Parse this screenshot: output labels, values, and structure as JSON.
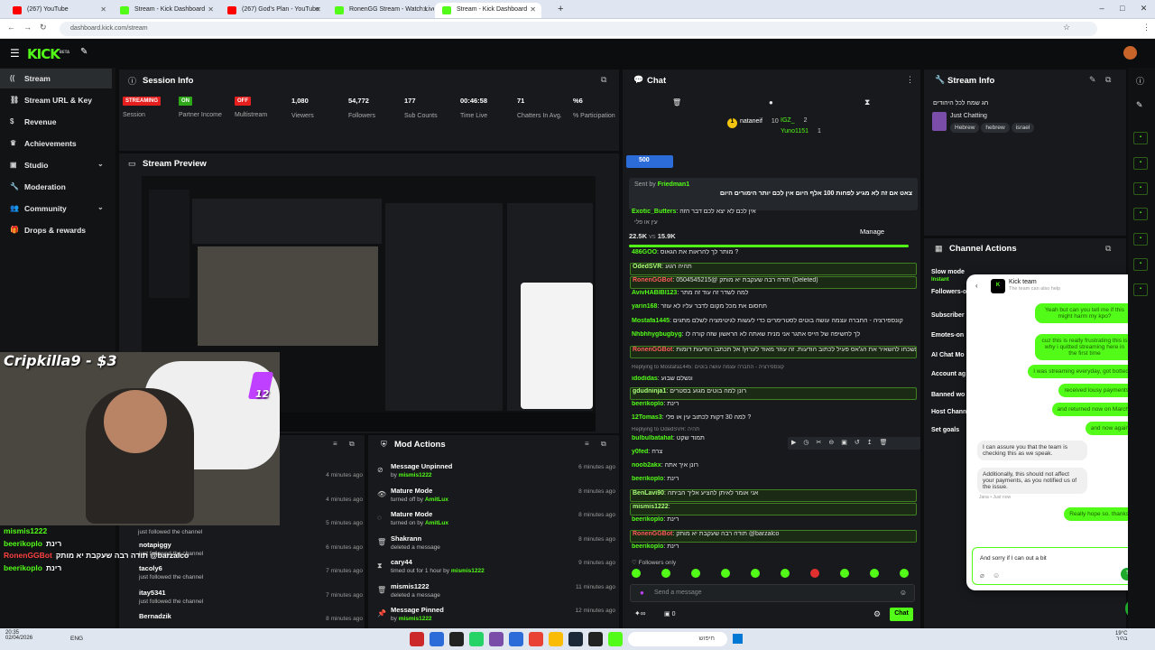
{
  "browser": {
    "tabs": [
      {
        "label": "(267) YouTube",
        "color": "#ff0000"
      },
      {
        "label": "Stream - Kick Dashboard",
        "color": "#53fc18"
      },
      {
        "label": "(267) God's Plan - YouTube",
        "color": "#ff0000"
      },
      {
        "label": "RonenGG Stream - Watch Live",
        "color": "#53fc18"
      },
      {
        "label": "Stream - Kick Dashboard",
        "color": "#53fc18"
      }
    ],
    "url": "dashboard.kick.com/stream",
    "new_tab": "+",
    "win_controls": [
      "–",
      "□",
      "✕"
    ]
  },
  "brand": {
    "logo": "KICK",
    "beta": "BETA"
  },
  "sidebar": {
    "items": [
      {
        "label": "Stream",
        "icon": "broadcast-icon"
      },
      {
        "label": "Stream URL & Key",
        "icon": "link-icon"
      },
      {
        "label": "Revenue",
        "icon": "dollar-icon"
      },
      {
        "label": "Achievements",
        "icon": "trophy-icon"
      },
      {
        "label": "Studio",
        "icon": "studio-icon"
      },
      {
        "label": "Moderation",
        "icon": "wrench-icon"
      },
      {
        "label": "Community",
        "icon": "people-icon"
      },
      {
        "label": "Drops & rewards",
        "icon": "gift-icon"
      }
    ]
  },
  "session": {
    "title": "Session Info",
    "stats": [
      {
        "value": "STREAMING",
        "label": "Session",
        "type": "badge",
        "color": "#e51e1e"
      },
      {
        "value": "ON",
        "label": "Partner Income",
        "type": "badge",
        "color": "#2fa81a"
      },
      {
        "value": "OFF",
        "label": "Multistream",
        "type": "badge",
        "color": "#e51e1e"
      },
      {
        "value": "1,080",
        "label": "Viewers"
      },
      {
        "value": "54,772",
        "label": "Followers"
      },
      {
        "value": "177",
        "label": "Sub Counts"
      },
      {
        "value": "00:46:58",
        "label": "Time Live"
      },
      {
        "value": "71",
        "label": "Chatters In Avg."
      },
      {
        "value": "%6",
        "label": "% Participation"
      }
    ]
  },
  "preview": {
    "title": "Stream Preview"
  },
  "overlay": {
    "donation": "Cripkilla9 - $3",
    "sub_count": "12"
  },
  "recent": {
    "items": [
      {
        "time": "4 minutes ago"
      },
      {
        "time": "4 minutes ago"
      },
      {
        "time": "5 minutes ago"
      },
      {
        "name": "notapiggy",
        "desc": "just followed the channel",
        "time": "6 minutes ago"
      },
      {
        "name": "tacoly6",
        "desc": "just followed the channel",
        "time": "7 minutes ago"
      },
      {
        "name": "itay5341",
        "desc": "just followed the channel",
        "time": "7 minutes ago"
      },
      {
        "name": "Bernadzik",
        "desc": "",
        "time": "8 minutes ago"
      }
    ],
    "partial_desc": "just followed the channel"
  },
  "overlay_chat": [
    {
      "user": "mismis1222",
      "text": ""
    },
    {
      "user": "beerikoplo",
      "text": "רינת"
    },
    {
      "user": "RonenGGBot",
      "text": "תודה רבה שעקבת יא מותק @barzalco"
    },
    {
      "user": "beerikoplo",
      "text": "רינת"
    }
  ],
  "mod": {
    "title": "Mod Actions",
    "items": [
      {
        "title": "Message Unpinned",
        "by": "by",
        "who": "mismis1222",
        "time": "6 minutes ago",
        "icon": "unpin-icon"
      },
      {
        "title": "Mature Mode",
        "by": "turned off by",
        "who": "AmitLux",
        "time": "8 minutes ago",
        "icon": "eye-icon"
      },
      {
        "title": "Mature Mode",
        "by": "turned on by",
        "who": "AmitLux",
        "time": "8 minutes ago",
        "icon": "eye-off-icon"
      },
      {
        "title": "Shakrann",
        "by": "deleted a message",
        "who": "",
        "time": "8 minutes ago",
        "icon": "trash-icon"
      },
      {
        "title": "cary44",
        "by": "timed out for 1 hour by",
        "who": "mismis1222",
        "time": "9 minutes ago",
        "icon": "clock-icon"
      },
      {
        "title": "mismis1222",
        "by": "deleted a message",
        "who": "",
        "time": "11 minutes ago",
        "icon": "trash-icon"
      },
      {
        "title": "Message Pinned",
        "by": "by",
        "who": "mismis1222",
        "time": "12 minutes ago",
        "icon": "pin-icon"
      }
    ]
  },
  "chat": {
    "title": "Chat",
    "leaderboard": [
      {
        "rank": "1",
        "name": "nataneif",
        "count": "10"
      },
      {
        "rank": "",
        "name": "IGZ_",
        "count": "2"
      },
      {
        "rank": "",
        "name": "Yuno1151",
        "count": "1"
      }
    ],
    "goal": "500",
    "pinned": {
      "label": "Sent by",
      "user": "Friedman1",
      "text": "צאט אם זה לא מגיע לפחות 100 אלף היום אין לכם יותר הימורים היום"
    },
    "prediction": {
      "left": "22.5K",
      "vs": "vs",
      "right": "15.9K",
      "manage": "Manage",
      "top": "עין או פלי"
    },
    "lines": [
      {
        "user": "Exotic_Butters",
        "text": "אין לכם לא יצא לכם דבר הזה",
        "hl": false
      },
      {
        "user": "486GOO",
        "text": "מותר לך להראות את הגאוס ?",
        "hl": false
      },
      {
        "user": "OdedSVR",
        "text": "תהיה רגוע",
        "hl": true
      },
      {
        "user": "RonenGGBot",
        "text": "0504545215@ תודה רבה שעקבת יא מותק (Deleted)",
        "hl": true,
        "red": true
      },
      {
        "user": "AvivHABIBI123",
        "text": "למה לשדר זה עוד זה מתר",
        "hl": false
      },
      {
        "user": "yarin168",
        "text": "תחסום את מכל מקום לדבר עליו לא עוזר",
        "hl": false
      },
      {
        "user": "Mostafa1445",
        "text": "קונספירציה - החברה עצמה עושה בוטים לסטרימרים כדי לעשות לגיטימציה לשלם מתגים",
        "hl": false
      },
      {
        "user": "Nhbhhygbugbyg",
        "text": "לך לחשיפה של הייס אתגר אני מנית שאתה לא הראשון שזה קורה לו",
        "hl": false
      },
      {
        "user": "RonenGGBot",
        "text": "אל תשכחו להשאיר את הג'אס פעיל לכתוב הודעות. זה עוזר מאוד לערוץ! אל תכתבו הודעות דומות",
        "hl": true,
        "red": true
      },
      {
        "user": "",
        "text": "Replying to Mostafa1445: קונספירציה - החברה עצמה עושה בוטים",
        "hl": false,
        "reply": true
      },
      {
        "user": "idodidas",
        "text": "ונשלם שבוע",
        "hl": false
      },
      {
        "user": "gdudninja1",
        "text": "רונן למה בוטים מגוע בסטרים",
        "hl": true
      },
      {
        "user": "beerikoplo",
        "text": "רינת",
        "hl": false
      },
      {
        "user": "12Tomas3",
        "text": "למה 30 דקות לכתוב עין או פלי ?",
        "hl": false
      },
      {
        "user": "",
        "text": "Replying to OdedSVR: תהיה",
        "hl": false,
        "reply": true
      },
      {
        "user": "bulbulbatahat",
        "text": "תמוד שקט",
        "hl": false
      },
      {
        "user": "y0fed",
        "text": "צרח",
        "hl": false
      },
      {
        "user": "noob2akx",
        "text": "רונן איך אתה",
        "hl": false
      },
      {
        "user": "beerikoplo",
        "text": "רינת",
        "hl": false
      },
      {
        "user": "BenLavi90",
        "text": "אני אומר לאיתן להציע אליך הביתה",
        "hl": true
      },
      {
        "user": "mismis1222",
        "text": "",
        "hl": true
      },
      {
        "user": "beerikoplo",
        "text": "רינת",
        "hl": false
      },
      {
        "user": "RonenGGBot",
        "text": "תודה רבה שעקבת יא מותק @barzalco",
        "hl": true,
        "red": true
      },
      {
        "user": "beerikoplo",
        "text": "רינת",
        "hl": false
      }
    ],
    "followers_only": "Followers only",
    "input_placeholder": "Send a message",
    "count": "0",
    "chat_button": "Chat"
  },
  "stream_info": {
    "title": "Stream Info",
    "stream_title": "חג שמח לכל היהודים",
    "category": "Just Chatting",
    "tags": [
      "Hebrew",
      "hebrew",
      "israel"
    ]
  },
  "channel_actions": {
    "title": "Channel Actions",
    "items": [
      "Slow mode",
      "Instant",
      "Followers-o",
      "Subscriber",
      "Emotes-on",
      "AI Chat Mo",
      "Account ag",
      "Banned wo",
      "Host Chann",
      "Set goals"
    ]
  },
  "support": {
    "title": "Kick team",
    "subtitle": "The team can also help",
    "messages": [
      {
        "from": "me",
        "text": "Yeah but can you tell me if this might harm my kpo?"
      },
      {
        "from": "me",
        "text": "cuz this is really frustrating this is why i quitted streaming here in the first time"
      },
      {
        "from": "me",
        "text": "I was streaming everyday, got botted"
      },
      {
        "from": "me",
        "text": "received lousy payments"
      },
      {
        "from": "me",
        "text": "and returned now on March"
      },
      {
        "from": "me",
        "text": "and now again"
      },
      {
        "from": "them",
        "text": "I can assure you that the team is checking this as we speak."
      },
      {
        "from": "them",
        "text": "Additionally, this should not affect your payments, as you notified us of the issue."
      },
      {
        "from": "meta",
        "text": "Jana • Just now"
      },
      {
        "from": "me",
        "text": "Really hope so. thanks"
      }
    ],
    "draft": "And sorry if I can out a bit"
  },
  "taskbar": {
    "time": "20:35",
    "date": "02/04/2026",
    "lang": "ENG",
    "search": "חיפוש",
    "temp": "19°C",
    "weather": "בהיר"
  },
  "colors": {
    "accent": "#53fc18",
    "panel": "#17191c",
    "bg": "#0b0d0f"
  }
}
